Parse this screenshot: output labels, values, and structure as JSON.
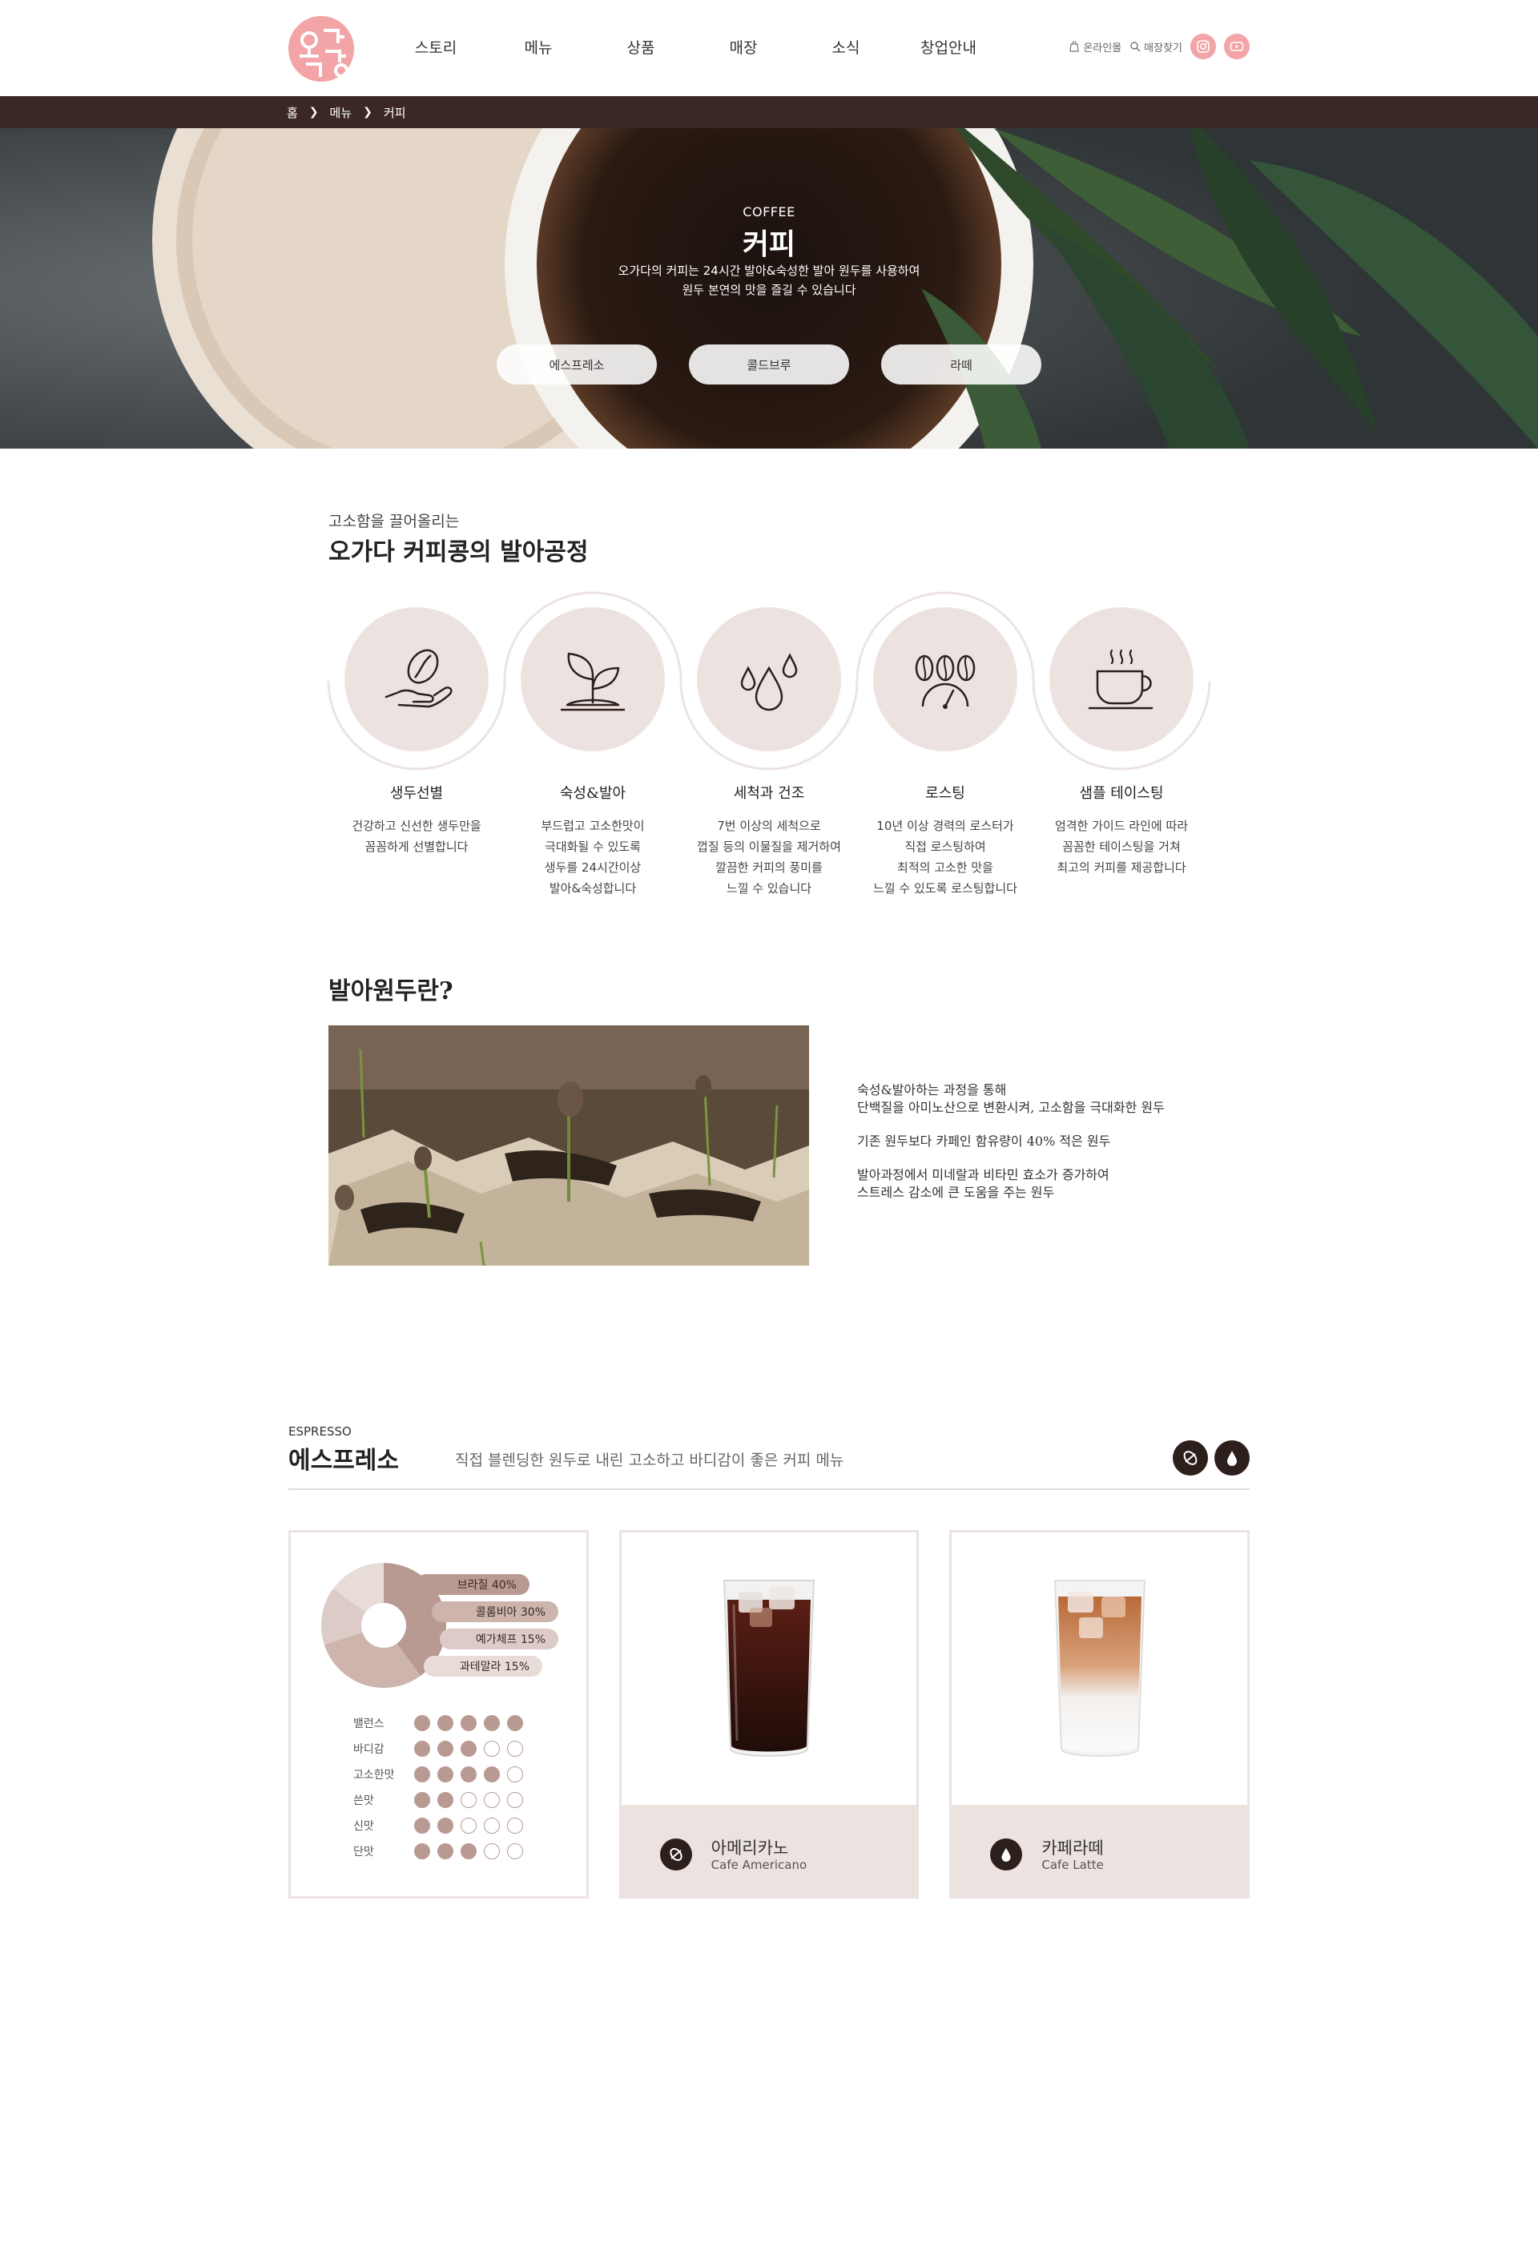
{
  "header": {
    "logo_text": "오가다",
    "nav": [
      "스토리",
      "메뉴",
      "상품",
      "매장",
      "소식",
      "창업안내"
    ],
    "util": {
      "online_mall": "온라인몰",
      "store_finder": "매장찾기"
    },
    "sns": [
      "instagram-icon",
      "youtube-icon"
    ]
  },
  "breadcrumb": [
    "홈",
    "메뉴",
    "커피"
  ],
  "hero": {
    "sub": "COFFEE",
    "title": "커피",
    "desc_line1": "오가다의 커피는 24시간 발아&숙성한 발아 원두를 사용하여",
    "desc_line2": "원두 본연의 맛을 즐길 수 있습니다",
    "buttons": [
      "에스프레소",
      "콜드브루",
      "라떼"
    ]
  },
  "process": {
    "sub": "고소함을 끌어올리는",
    "title": "오가다 커피콩의 발아공정",
    "steps": [
      {
        "name": "생두선별",
        "desc": "건강하고 신선한 생두만을\n꼼꼼하게 선별합니다",
        "icon": "bean-hand-icon"
      },
      {
        "name": "숙성&발아",
        "desc": "부드럽고 고소한맛이\n극대화될 수 있도록\n생두를 24시간이상\n발아&숙성합니다",
        "icon": "sprout-icon"
      },
      {
        "name": "세척과 건조",
        "desc": "7번 이상의 세척으로\n껍질 등의 이물질을 제거하여\n깔끔한 커피의 풍미를\n느낄 수 있습니다",
        "icon": "water-drops-icon"
      },
      {
        "name": "로스팅",
        "desc": "10년 이상 경력의 로스터가\n직접 로스팅하여\n최적의 고소한 맛을\n느낄 수 있도록 로스팅합니다",
        "icon": "roasting-beans-icon"
      },
      {
        "name": "샘플 테이스팅",
        "desc": "엄격한 가이드 라인에 따라\n꼼꼼한 테이스팅을 거쳐\n최고의 커피를 제공합니다",
        "icon": "coffee-cup-icon"
      }
    ]
  },
  "germination": {
    "title": "발아원두란?",
    "paragraphs": [
      "숙성&발아하는 과정을 통해\n단백질을 아미노산으로 변환시켜, 고소함을 극대화한 원두",
      "기존 원두보다 카페인 함유량이 40% 적은 원두",
      "발아과정에서 미네랄과 비타민 효소가 증가하여\n스트레스 감소에 큰 도움을 주는 원두"
    ]
  },
  "espresso": {
    "sub": "ESPRESSO",
    "title": "에스프레소",
    "desc": "직접 블렌딩한 원두로 내린 고소하고 바디감이 좋은 커피 메뉴",
    "filter_icons": [
      "bean-icon",
      "drop-icon"
    ],
    "blend": [
      {
        "label": "브라질 40%",
        "value": 40,
        "color": "#b99a92"
      },
      {
        "label": "콜롬비아 30%",
        "value": 30,
        "color": "#cdb4ad"
      },
      {
        "label": "예가체프 15%",
        "value": 15,
        "color": "#dccbc6"
      },
      {
        "label": "과테말라 15%",
        "value": 15,
        "color": "#e8dcd8"
      }
    ],
    "taste": [
      {
        "label": "밸런스",
        "score": 5
      },
      {
        "label": "바디감",
        "score": 3
      },
      {
        "label": "고소한맛",
        "score": 4
      },
      {
        "label": "쓴맛",
        "score": 2
      },
      {
        "label": "신맛",
        "score": 2
      },
      {
        "label": "단맛",
        "score": 3
      }
    ],
    "taste_max": 5,
    "products": [
      {
        "name": "아메리카노",
        "eng": "Cafe Americano",
        "icon": "bean-icon"
      },
      {
        "name": "카페라떼",
        "eng": "Cafe Latte",
        "icon": "drop-icon"
      }
    ]
  }
}
